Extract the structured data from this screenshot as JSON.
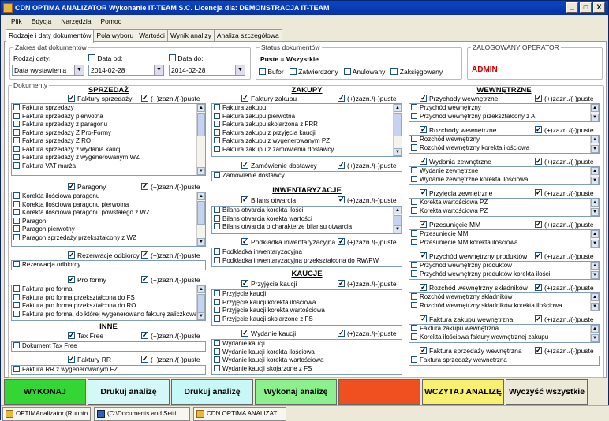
{
  "window": {
    "title": "CDN OPTIMA ANALIZATOR   Wykonanie IT-TEAM S.C.  Licencja dla: DEMONSTRACJA IT-TEAM",
    "min": "_",
    "max": "□",
    "close": "X"
  },
  "menu": [
    "Plik",
    "Edycja",
    "Narzędzia",
    "Pomoc"
  ],
  "tabs": [
    "Rodzaje i daty dokumentów",
    "Pola wyboru",
    "Wartości",
    "Wynik analizy",
    "Analiza szczegółowa"
  ],
  "dates": {
    "legend": "Zakres dat dokumentów",
    "type_label": "Rodzaj daty:",
    "type_value": "Data wystawienia",
    "from_label": "Data od:",
    "from_value": "2014-02-28",
    "to_label": "Data do:",
    "to_value": "2014-02-28"
  },
  "status": {
    "legend": "Status dokumentów",
    "value": "Puste = Wszystkie",
    "options": [
      "Bufor",
      "Zatwierdzony",
      "Anulowany",
      "Zaksięgowany"
    ]
  },
  "operator": {
    "legend": "ZALOGOWANY OPERATOR",
    "name": "ADMIN"
  },
  "docs": {
    "legend": "Dokumenty",
    "flag": "(+)zazn./(-)puste"
  },
  "col1": {
    "title": "SPRZEDAŻ",
    "g1": {
      "label": "Faktury sprzedaży",
      "items": [
        "Faktura sprzedaży",
        "Faktura sprzedaży pierwotna",
        "Faktura sprzedaży z paragonu",
        "Faktura sprzedaży Z Pro-Formy",
        "Faktura sprzedaży Z RO",
        "Faktura sprzedaży z wydania kaucji",
        "Faktura sprzedaży z wygenerowanym WZ",
        "Faktura VAT marża"
      ]
    },
    "g2": {
      "label": "Paragony",
      "items": [
        "Korekta ilościowa paragonu",
        "Korekta ilościowa paragonu pierwotna",
        "Korekta ilościowa paragonu powstałego z WZ",
        "Paragon",
        "Paragon pierwotny",
        "Paragon sprzedaży przekształcony z WZ"
      ]
    },
    "g3": {
      "label": "Rezerwacje odbiorcy",
      "items": [
        "Rezerwacja odbiorcy"
      ]
    },
    "g4": {
      "label": "Pro formy",
      "items": [
        "Faktura pro forma",
        "Faktura pro forma przekształcona do FS",
        "Faktura pro forma przekształcona do RO",
        "Faktura pro forma, do której wygenerowano fakturę zaliczkową"
      ]
    },
    "title2": "INNE",
    "g5": {
      "label": "Tax Free",
      "items": [
        "Dokument Tax Free"
      ]
    },
    "g6": {
      "label": "Faktury RR",
      "items": [
        "Faktura RR z wygenerowanym FZ"
      ]
    }
  },
  "col2": {
    "title": "ZAKUPY",
    "g1": {
      "label": "Faktury zakupu",
      "items": [
        "Faktura zakupu",
        "Faktura zakupu pierwotna",
        "Faktura zakupu skojarzona z FRR",
        "Faktura zakupu z przyjęcia kaucji",
        "Faktura zakupu z wygenerowanym PZ",
        "Faktura zakupu z zamówienia dostawcy"
      ]
    },
    "g2": {
      "label": "Zamówienie dostawcy",
      "items": [
        "Zamówienie dostawcy"
      ]
    },
    "title2": "INWENTARYZACJE",
    "g3": {
      "label": "Bilans otwarcia",
      "items": [
        "Bilans otwarcia korekta ilości",
        "Bilans otwarcia korekta wartości",
        "Bilans otwarcia o charakterze bilansu otwarcia"
      ]
    },
    "g4": {
      "label": "Podkładka inwentaryzacyjna",
      "items": [
        "Podkładka inwentaryzacyjna",
        "Podkładka inwentaryzacyjna przekształcona do RW/PW"
      ]
    },
    "title3": "KAUCJE",
    "g5": {
      "label": "Przyjęcie kaucji",
      "items": [
        "Przyjęcie kaucji",
        "Przyjęcie kaucji korekta ilościowa",
        "Przyjęcie kaucji korekta wartościowa",
        "Przyjęcie kaucji skojarzone z FS"
      ]
    },
    "g6": {
      "label": "Wydanie kaucji",
      "items": [
        "Wydanie kaucji",
        "Wydanie kaucji korekta ilościowa",
        "Wydanie kaucji korekta wartościowa",
        "Wydanie kaucji skojarzone z FS"
      ]
    }
  },
  "col3": {
    "title": "WEWNĘTRZNE",
    "groups": [
      {
        "label": "Przychody wewnętrzne",
        "items": [
          "Przychód wewnętrzny",
          "Przychód wewnętrzny przekształcony z AI"
        ]
      },
      {
        "label": "Rozchody wewnętrzne",
        "items": [
          "Rozchód wewnętrzny",
          "Rozchód wewnętrzny korekta ilościowa"
        ]
      },
      {
        "label": "Wydania zewnętrzne",
        "items": [
          "Wydanie zewnętrzne",
          "Wydanie zewnętrzne korekta ilościowa"
        ]
      },
      {
        "label": "Przyjęcia zewnętrzne",
        "items": [
          "Korekta wartościowa PZ",
          "Korekta wartościowa PZ"
        ]
      },
      {
        "label": "Przesunięcie MM",
        "items": [
          "Przesunięcie MM",
          "Przesunięcie MM korekta ilościowa"
        ]
      },
      {
        "label": "Przychód wewnętrzny produktów",
        "items": [
          "Przychód wewnętrzny produktów",
          "Przychód wewnętrzny produktów korekta ilości"
        ]
      },
      {
        "label": "Rozchód wewnętrzny składników",
        "items": [
          "Rozchód wewnętrzny składników",
          "Rozchód wewnętrzny składników korekta ilościowa"
        ]
      },
      {
        "label": "Faktura zakupu wewnętrzna",
        "items": [
          "Faktura zakupu wewnętrzna",
          "Korekta ilościowa faktury wewnętrznej zakupu"
        ]
      },
      {
        "label": "Faktura sprzedaży wewnętrzna",
        "items": [
          "Faktura sprzedaży wewnętrzna"
        ]
      }
    ]
  },
  "buttons": [
    {
      "label": "WYKONAJ",
      "color": "#34d634"
    },
    {
      "label": "Drukuj analizę",
      "color": "#d4f7f7"
    },
    {
      "label": "Drukuj analizę",
      "color": "#c8f7f7"
    },
    {
      "label": "Wykonaj analizę",
      "color": "#8cf08c"
    },
    {
      "label": "",
      "color": "#f05020"
    },
    {
      "label": "WCZYTAJ ANALIZĘ",
      "color": "#f7f070"
    },
    {
      "label": "Wyczyść wszystkie",
      "color": "#ece9d8"
    }
  ],
  "taskbar": [
    "OPTIMAnalizator (Runnin...",
    "(C:\\Documents and Setti...",
    "CDN OPTIMA ANALIZAT..."
  ]
}
